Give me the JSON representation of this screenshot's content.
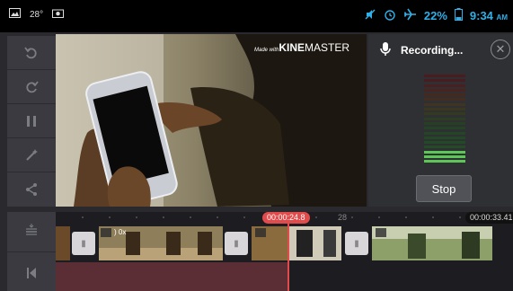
{
  "status_bar": {
    "temperature": "28°",
    "battery_percent": "22%",
    "time": "9:34",
    "ampm": "AM",
    "accent_color": "#2fb0e8"
  },
  "preview": {
    "watermark_prefix": "Made with",
    "watermark_brand_bold": "KINE",
    "watermark_brand_rest": "MASTER"
  },
  "recording": {
    "title": "Recording...",
    "stop_label": "Stop",
    "meter_level": 0.18
  },
  "timeline": {
    "playhead_time": "00:00:24.8",
    "ruler_mark": "28",
    "end_time": "00:00:33.41",
    "clip_speed_label": ") 0x",
    "playhead_color": "#e24b4b"
  },
  "toolbar": {
    "icons": [
      "undo-icon",
      "redo-icon",
      "pause-icon",
      "magic-wand-icon",
      "share-icon"
    ]
  }
}
